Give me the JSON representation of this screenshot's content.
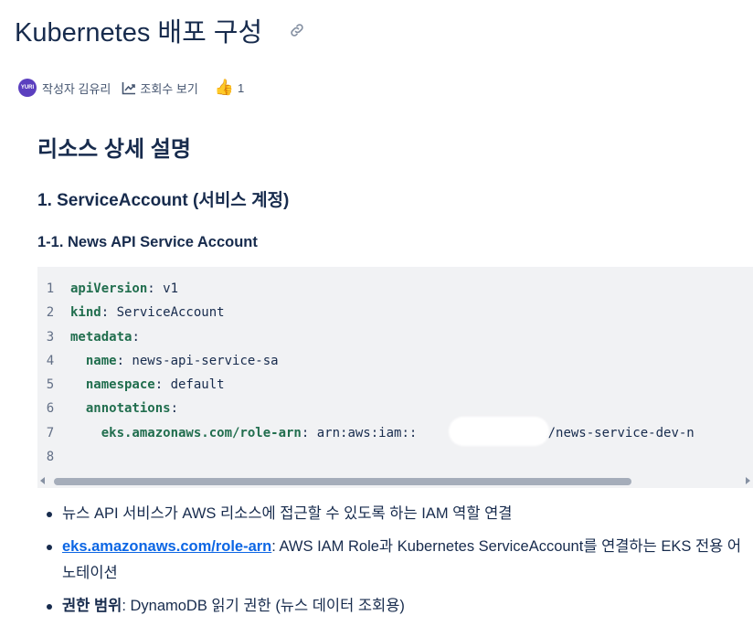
{
  "page": {
    "title": "Kubernetes 배포 구성",
    "author_avatar_text": "YURI",
    "author_label": "작성자 김유리",
    "views_label": "조회수 보기",
    "like_count": "1"
  },
  "content": {
    "h2": "리소스 상세 설명",
    "h3": "1. ServiceAccount (서비스 계정)",
    "h4": "1-1. News API Service Account",
    "code": {
      "line_numbers": [
        "1",
        "2",
        "3",
        "4",
        "5",
        "6",
        "7",
        "8"
      ],
      "lines": [
        {
          "key": "apiVersion",
          "sep": ": ",
          "value": "v1",
          "indent": ""
        },
        {
          "key": "kind",
          "sep": ": ",
          "value": "ServiceAccount",
          "indent": ""
        },
        {
          "key": "metadata",
          "sep": ":",
          "value": "",
          "indent": ""
        },
        {
          "key": "name",
          "sep": ": ",
          "value": "news-api-service-sa",
          "indent": "  "
        },
        {
          "key": "namespace",
          "sep": ": ",
          "value": "default",
          "indent": "  "
        },
        {
          "key": "annotations",
          "sep": ":",
          "value": "",
          "indent": "  "
        },
        {
          "key": "eks.amazonaws.com/role-arn",
          "sep": ": ",
          "value": "arn:aws:iam::            :role/news-service-dev-n",
          "indent": "    "
        },
        {
          "key": "",
          "sep": "",
          "value": "",
          "indent": ""
        }
      ]
    },
    "bullets": {
      "b1": "뉴스 API 서비스가 AWS 리소스에 접근할 수 있도록 하는 IAM 역할 연결",
      "b2_link": "eks.amazonaws.com/role-arn",
      "b2_rest": ": AWS IAM Role과 Kubernetes ServiceAccount를 연결하는 EKS 전용 어노테이션",
      "b3_bold": "권한 범위",
      "b3_rest": ": DynamoDB 읽기 권한 (뉴스 데이터 조회용)"
    }
  },
  "icons": {
    "link": "link-icon",
    "views": "trend-chart-icon",
    "like": "thumbs-up-icon"
  },
  "colors": {
    "yaml_key": "#216e4e",
    "link": "#0c66e4",
    "code_bg": "#f1f2f4",
    "avatar": "#5b3fbf"
  }
}
